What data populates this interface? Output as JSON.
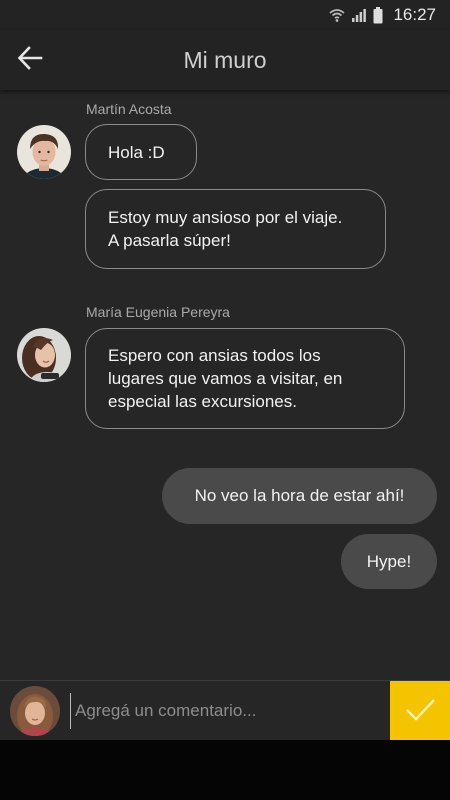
{
  "status_bar": {
    "time": "16:27",
    "icons": [
      "wifi-icon",
      "signal-icon",
      "battery-icon"
    ]
  },
  "app_bar": {
    "back_icon": "arrow-left-icon",
    "title": "Mi muro"
  },
  "messages": [
    {
      "author": "Martín Acosta",
      "avatar": "avatar-young-man",
      "texts": [
        "Hola :D",
        "Estoy muy ansioso por el viaje.\nA pasarla súper!"
      ]
    },
    {
      "author": "María Eugenia Pereyra",
      "avatar": "avatar-young-woman",
      "texts": [
        "Espero con ansias todos los\nlugares que vamos a visitar, en\nespecial las excursiones."
      ]
    }
  ],
  "my_messages": [
    "No veo la hora de estar ahí!",
    "Hype!"
  ],
  "compose": {
    "placeholder": "Agregá un comentario...",
    "send_icon": "check-icon"
  },
  "colors": {
    "accent": "#f5c400",
    "background": "#262626",
    "app_bar": "#232323",
    "outgoing_bubble": "#4a4a4a"
  }
}
